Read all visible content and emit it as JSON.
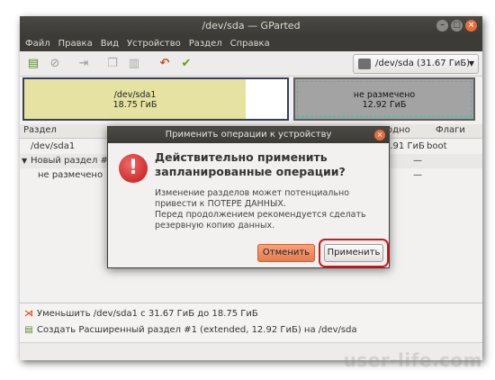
{
  "window": {
    "title": "/dev/sda — GParted"
  },
  "menu": {
    "items": [
      "Файл",
      "Правка",
      "Вид",
      "Устройство",
      "Раздел",
      "Справка"
    ]
  },
  "toolbar": {
    "icons": [
      "new-partition-icon",
      "delete-icon",
      "resize-move-icon",
      "copy-icon",
      "paste-icon",
      "undo-icon",
      "apply-icon"
    ],
    "device_selector": "/dev/sda  (31.67 ГиБ)"
  },
  "partition_map": {
    "sda1": {
      "name": "/dev/sda1",
      "size": "18.75 ГиБ"
    },
    "unallocated": {
      "name": "не размечено",
      "size": "12.92 ГиБ"
    }
  },
  "table": {
    "headers": {
      "partition": "Раздел",
      "size": "одно",
      "flags": "Флаги"
    },
    "rows": [
      {
        "name": "/dev/sda1",
        "size": "2.91 ГиБ",
        "flags": "boot"
      },
      {
        "name": "Новый раздел #1",
        "size": "—",
        "flags": ""
      },
      {
        "name": "не размечено",
        "size": "—",
        "flags": ""
      }
    ]
  },
  "operations": [
    "Уменьшить /dev/sda1 с 31.67 ГиБ до 18.75 ГиБ",
    "Создать Расширенный раздел #1 (extended, 12.92 ГиБ) на /dev/sda"
  ],
  "dialog": {
    "title": "Применить операции к устройству",
    "heading": "Действительно применить запланированные операции?",
    "body_line1": "Изменение разделов может потенциально привести к ПОТЕРЕ ДАННЫХ.",
    "body_line2": "Перед продолжением рекомендуется сделать резервную копию данных.",
    "cancel_label": "Отменить",
    "apply_label": "Применить"
  },
  "watermark": "user-life.com",
  "colors": {
    "used_fill": "#e5e2a2",
    "unallocated_fill": "#a3a3a3",
    "highlight": "#d4161b",
    "cancel_accent": "#ea7a4c"
  }
}
